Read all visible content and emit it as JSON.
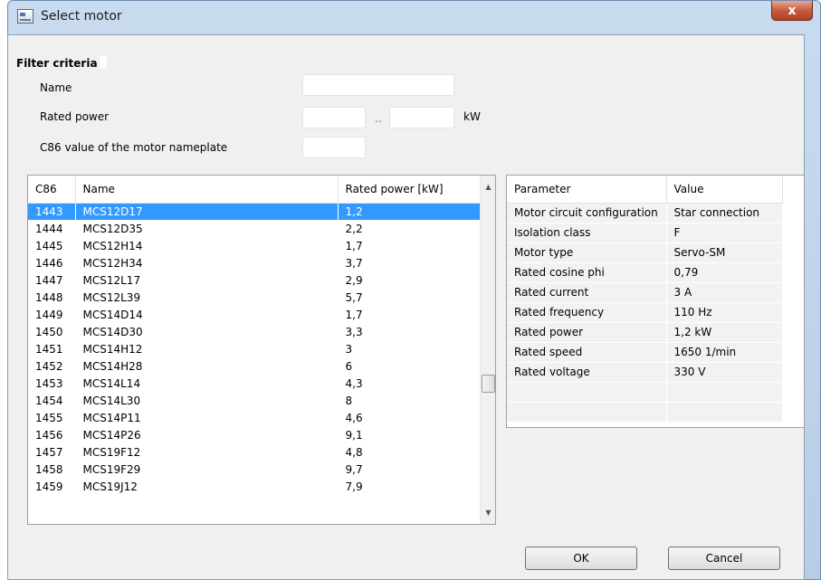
{
  "window": {
    "title": "Select motor",
    "close_label": "x"
  },
  "filter": {
    "title": "Filter criteria",
    "name_label": "Name",
    "name_value": "",
    "rated_power_label": "Rated power",
    "rated_power_min": "",
    "range_separator": "..",
    "rated_power_max": "",
    "unit": "kW",
    "c86_label": "C86 value of the motor nameplate",
    "c86_value": ""
  },
  "motor_table": {
    "columns": [
      "C86",
      "Name",
      "Rated power [kW]"
    ],
    "selected_index": 0,
    "rows": [
      [
        "1443",
        "MCS12D17",
        "1,2"
      ],
      [
        "1444",
        "MCS12D35",
        "2,2"
      ],
      [
        "1445",
        "MCS12H14",
        "1,7"
      ],
      [
        "1446",
        "MCS12H34",
        "3,7"
      ],
      [
        "1447",
        "MCS12L17",
        "2,9"
      ],
      [
        "1448",
        "MCS12L39",
        "5,7"
      ],
      [
        "1449",
        "MCS14D14",
        "1,7"
      ],
      [
        "1450",
        "MCS14D30",
        "3,3"
      ],
      [
        "1451",
        "MCS14H12",
        "3"
      ],
      [
        "1452",
        "MCS14H28",
        "6"
      ],
      [
        "1453",
        "MCS14L14",
        "4,3"
      ],
      [
        "1454",
        "MCS14L30",
        "8"
      ],
      [
        "1455",
        "MCS14P11",
        "4,6"
      ],
      [
        "1456",
        "MCS14P26",
        "9,1"
      ],
      [
        "1457",
        "MCS19F12",
        "4,8"
      ],
      [
        "1458",
        "MCS19F29",
        "9,7"
      ],
      [
        "1459",
        "MCS19J12",
        "7,9"
      ]
    ],
    "scroll_position": 0.62
  },
  "param_table": {
    "columns": [
      "Parameter",
      "Value"
    ],
    "rows": [
      [
        "Motor circuit configuration",
        "Star connection"
      ],
      [
        "Isolation class",
        "F"
      ],
      [
        "Motor type",
        "Servo-SM"
      ],
      [
        "Rated cosine phi",
        "0,79"
      ],
      [
        "Rated current",
        "3 A"
      ],
      [
        "Rated frequency",
        "110 Hz"
      ],
      [
        "Rated power",
        "1,2 kW"
      ],
      [
        "Rated speed",
        "1650 1/min"
      ],
      [
        "Rated voltage",
        "330 V"
      ]
    ],
    "empty_rows": 2
  },
  "buttons": {
    "ok": "OK",
    "cancel": "Cancel"
  },
  "icons": {
    "title": "window-app-icon",
    "close": "close-icon",
    "scroll_up": "up-arrow-icon",
    "scroll_down": "down-arrow-icon"
  }
}
